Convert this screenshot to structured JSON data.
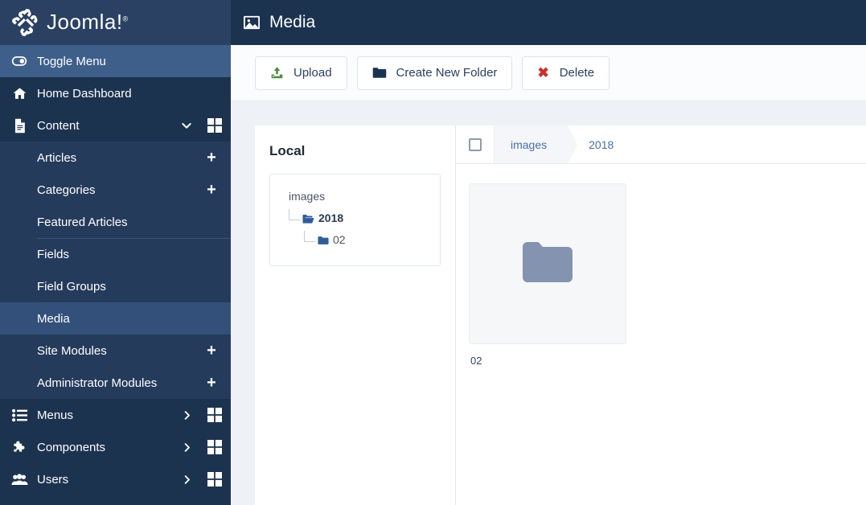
{
  "brand": {
    "name": "Joomla!",
    "registered": "®",
    "logo_icon": "joomla-logo-icon"
  },
  "sidebar": {
    "toggle": {
      "label": "Toggle Menu",
      "icon": "toggle-switch-icon"
    },
    "items": [
      {
        "label": "Home Dashboard",
        "icon": "home-icon",
        "has_chevron": false,
        "has_grid": false
      },
      {
        "label": "Content",
        "icon": "document-icon",
        "chevron": "chevron-down-icon",
        "grid": "grid-icon"
      },
      {
        "label": "Menus",
        "icon": "list-icon",
        "chevron": "chevron-right-icon",
        "grid": "grid-icon"
      },
      {
        "label": "Components",
        "icon": "puzzle-icon",
        "chevron": "chevron-right-icon",
        "grid": "grid-icon"
      },
      {
        "label": "Users",
        "icon": "users-icon",
        "chevron": "chevron-right-icon",
        "grid": "grid-icon"
      }
    ],
    "content_submenu": [
      {
        "label": "Articles",
        "plus": "+",
        "divider": false,
        "active": false
      },
      {
        "label": "Categories",
        "plus": "+",
        "divider": false,
        "active": false
      },
      {
        "label": "Featured Articles",
        "plus": "",
        "divider": false,
        "active": false
      },
      {
        "label": "Fields",
        "plus": "",
        "divider": true,
        "active": false
      },
      {
        "label": "Field Groups",
        "plus": "",
        "divider": false,
        "active": false
      },
      {
        "label": "Media",
        "plus": "",
        "divider": true,
        "active": true
      },
      {
        "label": "Site Modules",
        "plus": "+",
        "divider": false,
        "active": false
      },
      {
        "label": "Administrator Modules",
        "plus": "+",
        "divider": false,
        "active": false
      }
    ]
  },
  "header": {
    "title": "Media",
    "icon": "image-icon"
  },
  "toolbar": {
    "upload_label": "Upload",
    "upload_icon": "upload-icon",
    "create_folder_label": "Create New Folder",
    "create_folder_icon": "folder-icon",
    "delete_label": "Delete",
    "delete_icon": "x-mark-icon"
  },
  "tree": {
    "title": "Local",
    "root": "images",
    "nodes": [
      {
        "label": "2018",
        "icon": "folder-open-icon",
        "bold": true
      },
      {
        "label": "02",
        "icon": "folder-closed-icon",
        "bold": false
      }
    ]
  },
  "breadcrumb": {
    "items": [
      "images",
      "2018"
    ]
  },
  "media": {
    "items": [
      {
        "name": "02",
        "type": "folder",
        "icon": "folder-thumb-icon"
      }
    ]
  },
  "colors": {
    "sidebar_bg": "#1c3350",
    "submenu_bg": "#253b5c",
    "toggle_bg": "#3e5f8a",
    "active_item_bg": "#32507a",
    "content_bg": "#eef2f6",
    "accent_link": "#4a6fa5",
    "upload_green": "#4f8a3d",
    "delete_red": "#c9302c",
    "folder_thumb": "#8494b0"
  }
}
